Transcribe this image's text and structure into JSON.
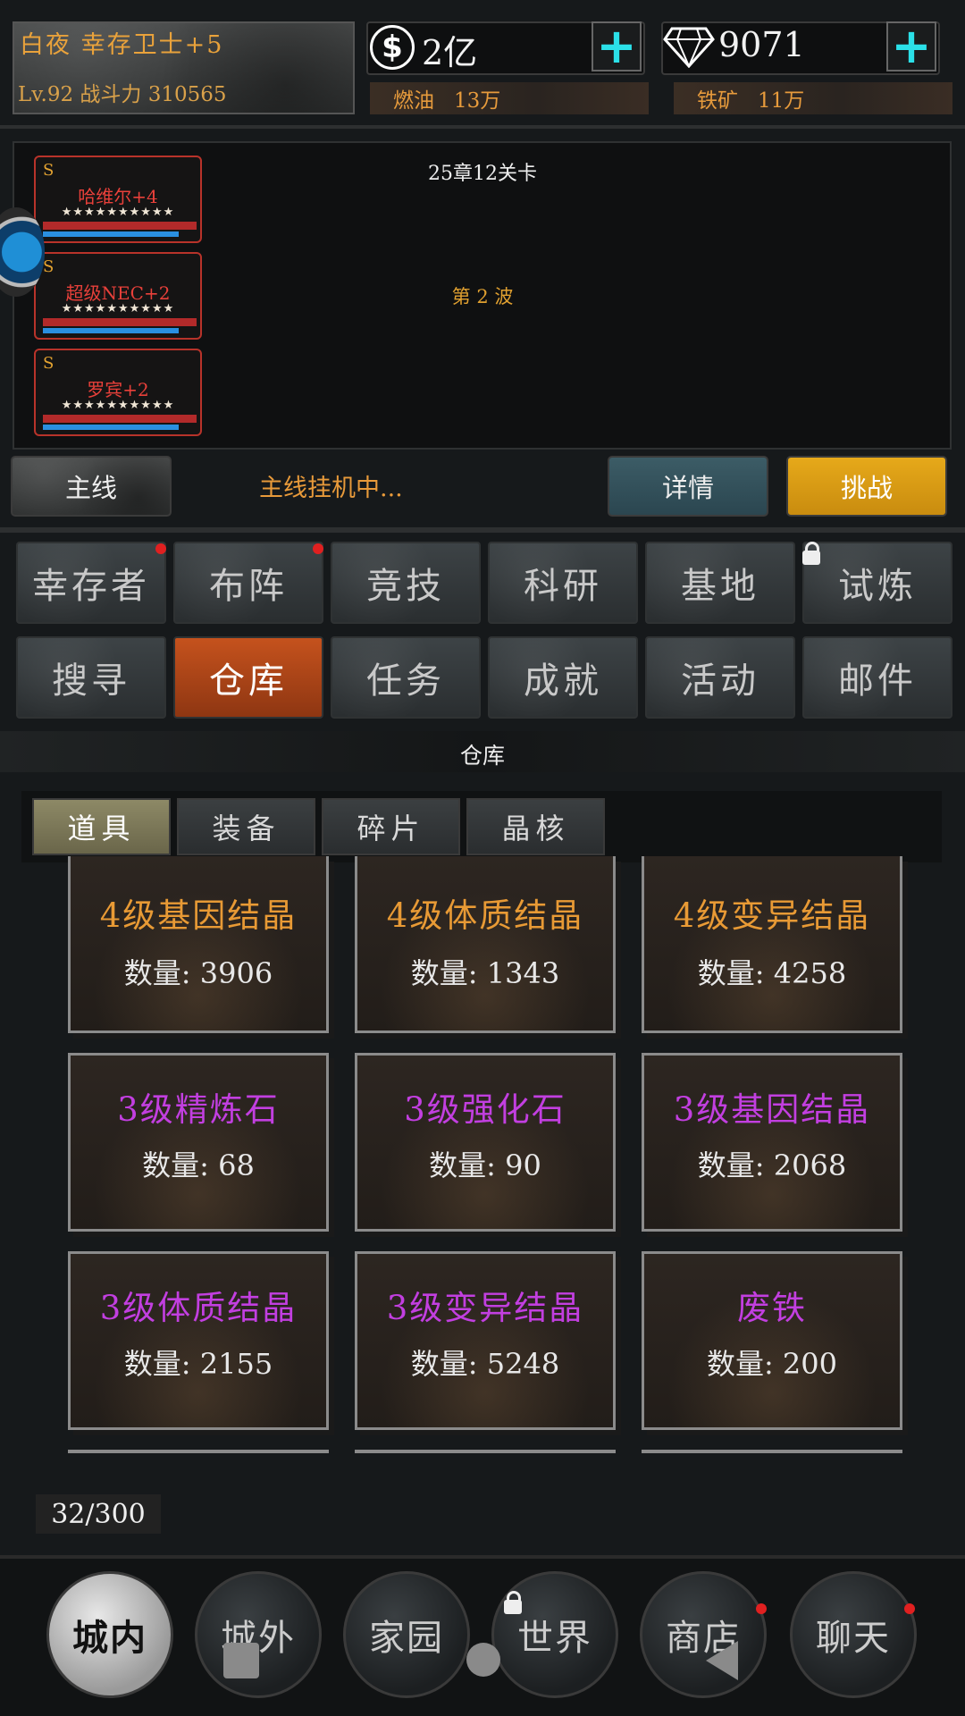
{
  "header": {
    "player_name": "白夜 幸存卫士+5",
    "player_level": "Lv.92 战斗力 310565",
    "money": "2亿",
    "diamonds": "9071",
    "fuel_label": "燃油",
    "fuel_value": "13万",
    "iron_label": "铁矿",
    "iron_value": "11万"
  },
  "battle": {
    "stage": "25章12关卡",
    "wave": "第 2 波",
    "heroes": [
      {
        "rank": "S",
        "name": "哈维尔+4",
        "stars": "★★★★★★★★★★"
      },
      {
        "rank": "S",
        "name": "超级NEC+2",
        "stars": "★★★★★★★★★★"
      },
      {
        "rank": "S",
        "name": "罗宾+2",
        "stars": "★★★★★★★★★★"
      }
    ],
    "main_button": "主线",
    "status": "主线挂机中...",
    "detail_button": "详情",
    "challenge_button": "挑战"
  },
  "nav_grid": [
    {
      "label": "幸存者"
    },
    {
      "label": "布阵"
    },
    {
      "label": "竞技"
    },
    {
      "label": "科研"
    },
    {
      "label": "基地"
    },
    {
      "label": "试炼"
    },
    {
      "label": "搜寻"
    },
    {
      "label": "仓库"
    },
    {
      "label": "任务"
    },
    {
      "label": "成就"
    },
    {
      "label": "活动"
    },
    {
      "label": "邮件"
    }
  ],
  "warehouse": {
    "title": "仓库",
    "tabs": [
      "道具",
      "装备",
      "碎片",
      "晶核"
    ],
    "qty_prefix": "数量:",
    "items": [
      {
        "name": "4级基因结晶",
        "qty": "数量: 3906"
      },
      {
        "name": "4级体质结晶",
        "qty": "数量: 1343"
      },
      {
        "name": "4级变异结晶",
        "qty": "数量: 4258"
      },
      {
        "name": "3级精炼石",
        "qty": "数量: 68"
      },
      {
        "name": "3级强化石",
        "qty": "数量: 90"
      },
      {
        "name": "3级基因结晶",
        "qty": "数量: 2068"
      },
      {
        "name": "3级体质结晶",
        "qty": "数量: 2155"
      },
      {
        "name": "3级变异结晶",
        "qty": "数量: 5248"
      },
      {
        "name": "废铁",
        "qty": "数量: 200"
      }
    ],
    "capacity": "32/300"
  },
  "bottom_nav": [
    "城内",
    "城外",
    "家园",
    "世界",
    "商店",
    "聊天"
  ],
  "colors": {
    "orange_item": "#e89a35",
    "purple_item": "#c23fe0",
    "accent_cyan": "#2be0e8",
    "challenge_gold": "#e6a91a",
    "active_nav": "#c5521d"
  }
}
